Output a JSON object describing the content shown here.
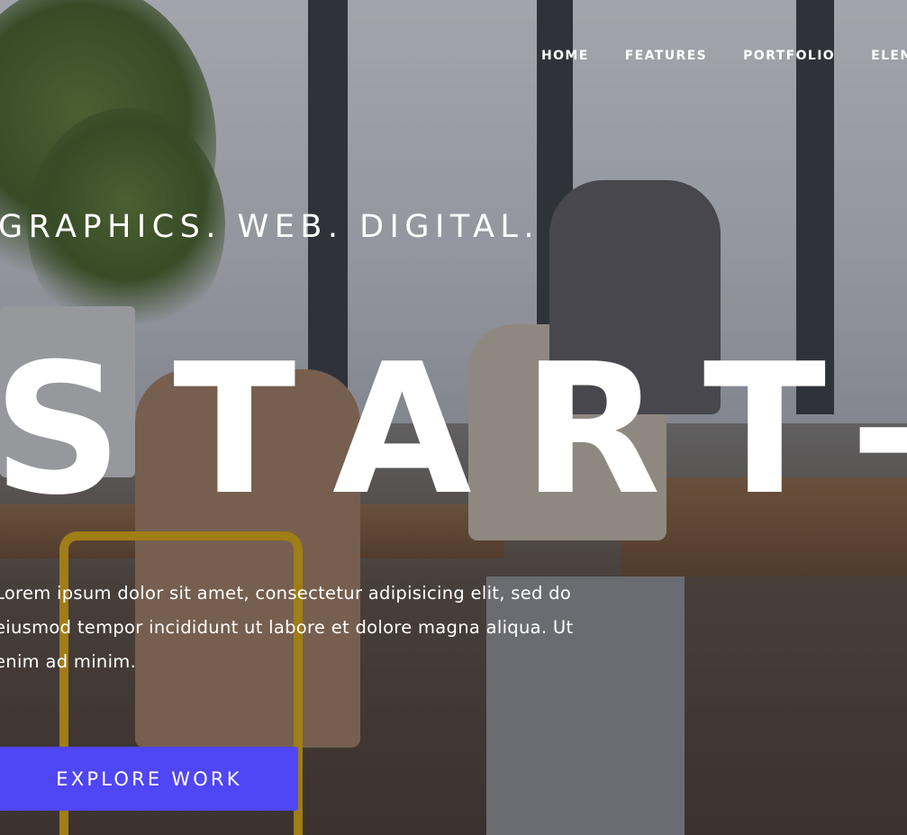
{
  "nav": {
    "items": [
      {
        "label": "HOME"
      },
      {
        "label": "FEATURES"
      },
      {
        "label": "PORTFOLIO"
      },
      {
        "label": "ELEMENTS"
      }
    ]
  },
  "hero": {
    "kicker": "GRAPHICS. WEB. DIGITAL.",
    "title": "START-UP",
    "lead": "Lorem ipsum dolor sit amet, consectetur adipisicing elit, sed do eiusmod tempor incididunt ut labore et dolore magna aliqua. Ut enim ad minim.",
    "cta_label": "EXPLORE WORK"
  },
  "colors": {
    "accent": "#4f46f5",
    "text": "#ffffff"
  }
}
